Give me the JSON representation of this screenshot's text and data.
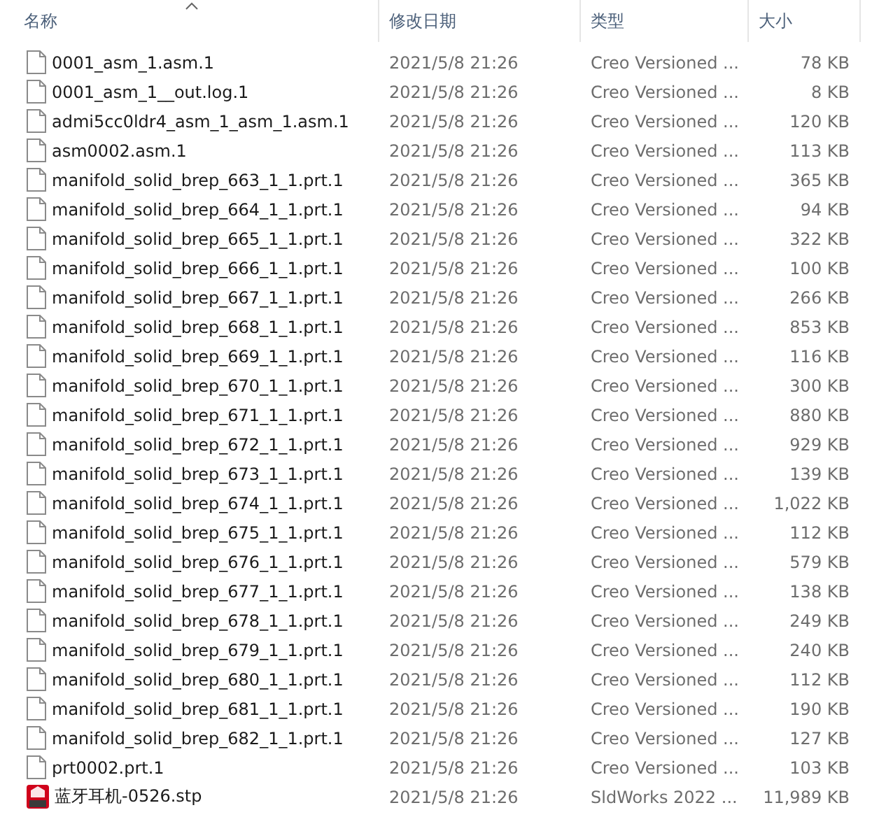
{
  "columns": [
    {
      "label": "名称",
      "sorted": true
    },
    {
      "label": "修改日期",
      "sorted": false
    },
    {
      "label": "类型",
      "sorted": false
    },
    {
      "label": "大小",
      "sorted": false
    }
  ],
  "rows": [
    {
      "kind": "file",
      "name": "0001_asm_1.asm.1",
      "date": "2021/5/8 21:26",
      "type": "Creo Versioned ...",
      "size": "78 KB"
    },
    {
      "kind": "file",
      "name": "0001_asm_1__out.log.1",
      "date": "2021/5/8 21:26",
      "type": "Creo Versioned ...",
      "size": "8 KB"
    },
    {
      "kind": "file",
      "name": "admi5cc0ldr4_asm_1_asm_1.asm.1",
      "date": "2021/5/8 21:26",
      "type": "Creo Versioned ...",
      "size": "120 KB"
    },
    {
      "kind": "file",
      "name": "asm0002.asm.1",
      "date": "2021/5/8 21:26",
      "type": "Creo Versioned ...",
      "size": "113 KB"
    },
    {
      "kind": "file",
      "name": "manifold_solid_brep_663_1_1.prt.1",
      "date": "2021/5/8 21:26",
      "type": "Creo Versioned ...",
      "size": "365 KB"
    },
    {
      "kind": "file",
      "name": "manifold_solid_brep_664_1_1.prt.1",
      "date": "2021/5/8 21:26",
      "type": "Creo Versioned ...",
      "size": "94 KB"
    },
    {
      "kind": "file",
      "name": "manifold_solid_brep_665_1_1.prt.1",
      "date": "2021/5/8 21:26",
      "type": "Creo Versioned ...",
      "size": "322 KB"
    },
    {
      "kind": "file",
      "name": "manifold_solid_brep_666_1_1.prt.1",
      "date": "2021/5/8 21:26",
      "type": "Creo Versioned ...",
      "size": "100 KB"
    },
    {
      "kind": "file",
      "name": "manifold_solid_brep_667_1_1.prt.1",
      "date": "2021/5/8 21:26",
      "type": "Creo Versioned ...",
      "size": "266 KB"
    },
    {
      "kind": "file",
      "name": "manifold_solid_brep_668_1_1.prt.1",
      "date": "2021/5/8 21:26",
      "type": "Creo Versioned ...",
      "size": "853 KB"
    },
    {
      "kind": "file",
      "name": "manifold_solid_brep_669_1_1.prt.1",
      "date": "2021/5/8 21:26",
      "type": "Creo Versioned ...",
      "size": "116 KB"
    },
    {
      "kind": "file",
      "name": "manifold_solid_brep_670_1_1.prt.1",
      "date": "2021/5/8 21:26",
      "type": "Creo Versioned ...",
      "size": "300 KB"
    },
    {
      "kind": "file",
      "name": "manifold_solid_brep_671_1_1.prt.1",
      "date": "2021/5/8 21:26",
      "type": "Creo Versioned ...",
      "size": "880 KB"
    },
    {
      "kind": "file",
      "name": "manifold_solid_brep_672_1_1.prt.1",
      "date": "2021/5/8 21:26",
      "type": "Creo Versioned ...",
      "size": "929 KB"
    },
    {
      "kind": "file",
      "name": "manifold_solid_brep_673_1_1.prt.1",
      "date": "2021/5/8 21:26",
      "type": "Creo Versioned ...",
      "size": "139 KB"
    },
    {
      "kind": "file",
      "name": "manifold_solid_brep_674_1_1.prt.1",
      "date": "2021/5/8 21:26",
      "type": "Creo Versioned ...",
      "size": "1,022 KB"
    },
    {
      "kind": "file",
      "name": "manifold_solid_brep_675_1_1.prt.1",
      "date": "2021/5/8 21:26",
      "type": "Creo Versioned ...",
      "size": "112 KB"
    },
    {
      "kind": "file",
      "name": "manifold_solid_brep_676_1_1.prt.1",
      "date": "2021/5/8 21:26",
      "type": "Creo Versioned ...",
      "size": "579 KB"
    },
    {
      "kind": "file",
      "name": "manifold_solid_brep_677_1_1.prt.1",
      "date": "2021/5/8 21:26",
      "type": "Creo Versioned ...",
      "size": "138 KB"
    },
    {
      "kind": "file",
      "name": "manifold_solid_brep_678_1_1.prt.1",
      "date": "2021/5/8 21:26",
      "type": "Creo Versioned ...",
      "size": "249 KB"
    },
    {
      "kind": "file",
      "name": "manifold_solid_brep_679_1_1.prt.1",
      "date": "2021/5/8 21:26",
      "type": "Creo Versioned ...",
      "size": "240 KB"
    },
    {
      "kind": "file",
      "name": "manifold_solid_brep_680_1_1.prt.1",
      "date": "2021/5/8 21:26",
      "type": "Creo Versioned ...",
      "size": "112 KB"
    },
    {
      "kind": "file",
      "name": "manifold_solid_brep_681_1_1.prt.1",
      "date": "2021/5/8 21:26",
      "type": "Creo Versioned ...",
      "size": "190 KB"
    },
    {
      "kind": "file",
      "name": "manifold_solid_brep_682_1_1.prt.1",
      "date": "2021/5/8 21:26",
      "type": "Creo Versioned ...",
      "size": "127 KB"
    },
    {
      "kind": "file",
      "name": "prt0002.prt.1",
      "date": "2021/5/8 21:26",
      "type": "Creo Versioned ...",
      "size": "103 KB"
    },
    {
      "kind": "solidworks",
      "name": "蓝牙耳机-0526.stp",
      "date": "2021/5/8 21:26",
      "type": "SldWorks 2022 ...",
      "size": "11,989 KB"
    }
  ]
}
